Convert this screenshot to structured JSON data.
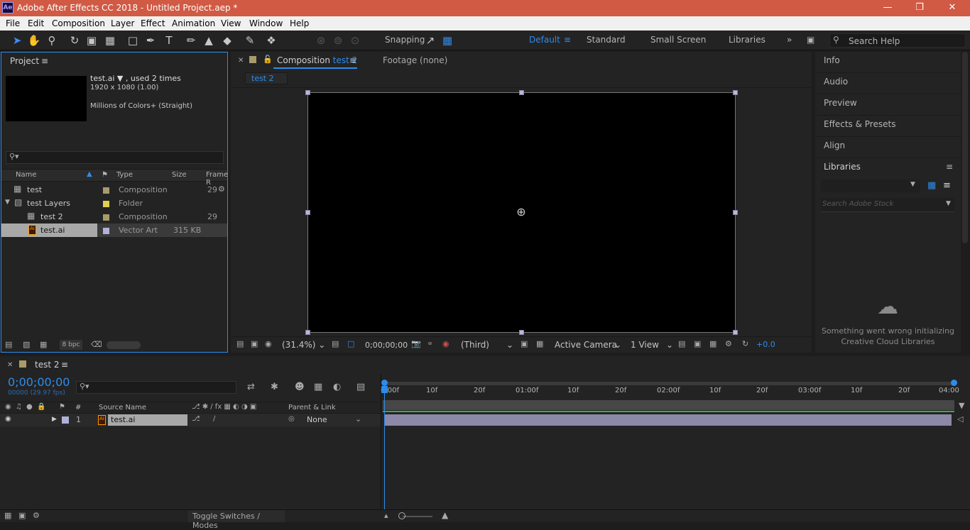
{
  "app": {
    "title": "Adobe After Effects CC 2018 - Untitled Project.aep *",
    "logo_text": "Ae"
  },
  "menu": [
    "File",
    "Edit",
    "Composition",
    "Layer",
    "Effect",
    "Animation",
    "View",
    "Window",
    "Help"
  ],
  "toolbar": {
    "snapping_label": "Snapping",
    "workspaces": [
      "Default",
      "Standard",
      "Small Screen",
      "Libraries"
    ],
    "active_workspace": "Default",
    "search_placeholder": "Search Help"
  },
  "project": {
    "tab_label": "Project",
    "selected_name": "test.ai",
    "used_text": ", used 2 times",
    "dimensions": "1920 x 1080 (1.00)",
    "color_depth": "Millions of Colors+ (Straight)",
    "columns": [
      "Name",
      "Type",
      "Size",
      "Frame R"
    ],
    "items": [
      {
        "name": "test",
        "type": "Composition",
        "size": "",
        "frame": "29",
        "icon": "composition-icon",
        "label_color": "#a89a6a"
      },
      {
        "name": "test Layers",
        "type": "Folder",
        "size": "",
        "frame": "",
        "icon": "folder-icon",
        "label_color": "#e0d050"
      },
      {
        "name": "test 2",
        "type": "Composition",
        "size": "",
        "frame": "29",
        "icon": "composition-icon",
        "label_color": "#a89a6a"
      },
      {
        "name": "test.ai",
        "type": "Vector Art",
        "size": "315 KB",
        "frame": "",
        "icon": "ai-file-icon",
        "label_color": "#b0b0d8"
      }
    ],
    "bpc": "8 bpc"
  },
  "composition": {
    "tab_prefix": "Composition",
    "tab_name": "test 2",
    "footage_tab": "Footage (none)",
    "subtab": "test 2",
    "zoom": "(31.4%)",
    "timecode": "0;00;00;00",
    "resolution": "(Third)",
    "camera": "Active Camera",
    "views": "1 View",
    "exposure": "+0.0"
  },
  "right_panel": {
    "items": [
      "Info",
      "Audio",
      "Preview",
      "Effects & Presets",
      "Align"
    ],
    "libraries_label": "Libraries",
    "stock_placeholder": "Search Adobe Stock",
    "error_line1": "Something went wrong initializing",
    "error_line2": "Creative Cloud Libraries"
  },
  "timeline": {
    "tab_label": "test 2",
    "timecode": "0;00;00;00",
    "fps": "00000 (29.97 fps)",
    "columns": {
      "source": "Source Name",
      "parent": "Parent & Link",
      "num": "#"
    },
    "layer": {
      "num": "1",
      "name": "test.ai",
      "parent": "None"
    },
    "ruler": [
      "0:00f",
      "10f",
      "20f",
      "01:00f",
      "10f",
      "20f",
      "02:00f",
      "10f",
      "20f",
      "03:00f",
      "10f",
      "20f",
      "04:00"
    ],
    "toggle_label": "Toggle Switches / Modes"
  }
}
